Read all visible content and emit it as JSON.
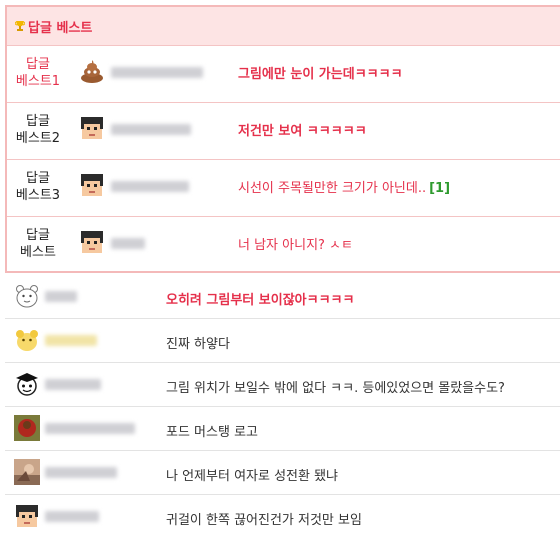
{
  "best_section": {
    "title": "답글 베스트",
    "title_icon": "trophy-icon",
    "accent_color": "#e5304b",
    "rows": [
      {
        "rank_line1": "답글",
        "rank_line2": "베스트1",
        "avatar_icon": "poop-avatar-icon",
        "text": "그림에만 눈이 가는데ㅋㅋㅋㅋ",
        "count": ""
      },
      {
        "rank_line1": "답글",
        "rank_line2": "베스트2",
        "avatar_icon": "pixel-face-avatar-icon",
        "text": "저건만 보여 ㅋㅋㅋㅋㅋ",
        "count": ""
      },
      {
        "rank_line1": "답글",
        "rank_line2": "베스트3",
        "avatar_icon": "pixel-face-avatar-icon",
        "text": "시선이 주목될만한 크기가 아닌데..",
        "count": "[1]"
      },
      {
        "rank_line1": "답글",
        "rank_line2": "베스트",
        "avatar_icon": "pixel-face-avatar-icon",
        "text": "너 남자 아니지? ㅅㅌ",
        "count": ""
      }
    ]
  },
  "comments": [
    {
      "avatar_icon": "bear-avatar-icon",
      "text": "오히려 그림부터 보이잖아ㅋㅋㅋㅋ",
      "highlight": true
    },
    {
      "avatar_icon": "yellow-creature-avatar-icon",
      "text": "진짜 하얗다",
      "highlight": false
    },
    {
      "avatar_icon": "graduate-avatar-icon",
      "text": "그림 위치가 보일수 밖에 없다 ㅋㅋ. 등에있었으면 몰랐을수도?",
      "highlight": false
    },
    {
      "avatar_icon": "red-photo-avatar-icon",
      "text": "포드 머스탱 로고",
      "highlight": false
    },
    {
      "avatar_icon": "photo-avatar-icon",
      "text": "나 언제부터 여자로 성전환 됐냐",
      "highlight": false
    },
    {
      "avatar_icon": "pixel-face-avatar-icon",
      "text": "귀걸이 한쪽 끊어진건가 저것만 보임",
      "highlight": false
    }
  ]
}
